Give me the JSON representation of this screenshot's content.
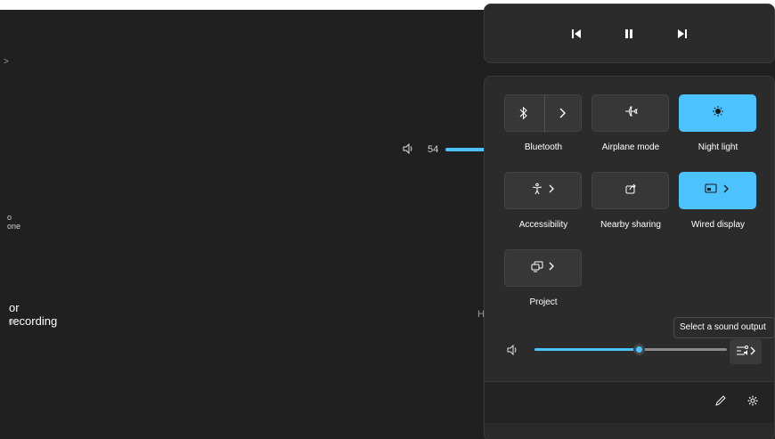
{
  "background_window": {
    "rows": [
      {
        "text": ">"
      },
      {
        "text": ""
      },
      {
        "text": ""
      },
      {
        "text": "o one"
      },
      {
        "text": ""
      },
      {
        "title": "or recording",
        "subtitle": "gs"
      },
      {
        "text": ""
      },
      {
        "text": ""
      }
    ],
    "volume": {
      "value": "54",
      "icon": "speaker-icon"
    },
    "partial_text": "H"
  },
  "media": {
    "previous_icon": "previous-track-icon",
    "pause_icon": "pause-icon",
    "next_icon": "next-track-icon"
  },
  "quick_settings": {
    "tiles": [
      {
        "label": "Bluetooth",
        "icon": "bluetooth-icon",
        "active": false
      },
      {
        "label": "Airplane mode",
        "icon": "airplane-icon",
        "active": false
      },
      {
        "label": "Night light",
        "icon": "night-light-icon",
        "active": true
      },
      {
        "label": "Accessibility",
        "icon": "accessibility-icon",
        "active": false
      },
      {
        "label": "Nearby sharing",
        "icon": "share-icon",
        "active": false
      },
      {
        "label": "Wired display",
        "icon": "cast-icon",
        "active": true
      },
      {
        "label": "Project",
        "icon": "project-icon",
        "active": false
      }
    ],
    "volume_slider": {
      "level_percent": 54,
      "icon": "speaker-icon"
    },
    "tooltip": "Select a sound output",
    "footer": {
      "edit_icon": "pencil-icon",
      "settings_icon": "gear-icon"
    }
  },
  "colors": {
    "accent": "#4cc2ff",
    "panel": "#2b2b2b",
    "tile": "#373737"
  }
}
